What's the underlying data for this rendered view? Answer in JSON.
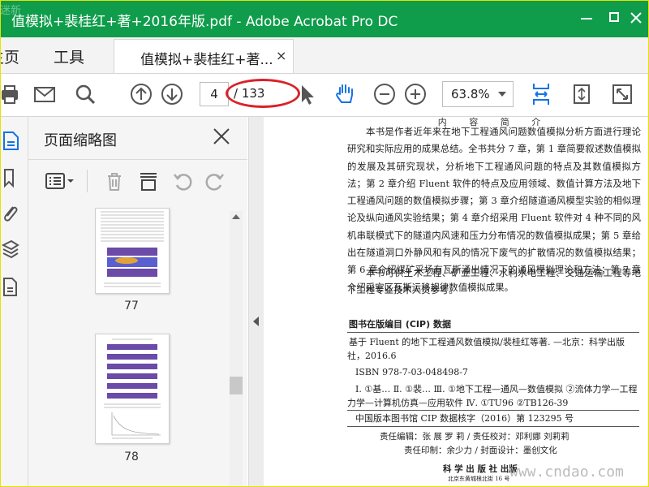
{
  "window": {
    "title": "值模拟+裴桂红+著+2016年版.pdf - Adobe Acrobat Pro DC",
    "watermark_logo": "迷新"
  },
  "tabs": {
    "nav": [
      "主页",
      "工具"
    ],
    "document_tab": "值模拟+裴桂红+著...",
    "close": "×"
  },
  "toolbar": {
    "current_page": "4",
    "total_pages": "/ 133",
    "zoom": "63.8%"
  },
  "panel": {
    "title": "页面缩略图",
    "thumbnails": [
      {
        "page": "77"
      },
      {
        "page": "78"
      }
    ]
  },
  "document": {
    "heading": "内 容 简 介",
    "para1": "本书是作者近年来在地下工程通风问题数值模拟分析方面进行理论研究和实际应用的成果总结。全书共分 7 章，第 1 章简要叙述数值模拟的发展及其研究现状，分析地下工程通风问题的特点及其数值模拟方法；第 2 章介绍 Fluent 软件的特点及应用领域、数值计算方法及地下工程通风问题的数值模拟步骤；第 3 章介绍隧道通风模型实验的相似理论及纵向通风实验结果；第 4 章介绍采用 Fluent 软件对 4 种不同的风机串联模式下的隧道内风速和压力分布情况的数值模拟成果；第 5 章给出在隧道洞口外静风和有风的情况下废气的扩散情况的数值模拟结果；第 6 章介绍煤矿采场有瓦斯涌出情况下的通风模拟理论和方法；第 7 章介绍采空区瓦斯运移规律数值模拟成果。",
    "para2": "本书可供土木工程、矿业工程、水利水电工程、交通运输工程等地下工程专业技术人员参考。",
    "cip_title": "图书在版编目 (CIP) 数据",
    "cip_line1": "基于 Fluent 的地下工程通风数值模拟/裴桂红等著. —北京：科学出版社，2016.6",
    "cip_isbn": "ISBN 978-7-03-048498-7",
    "cip_class": "Ⅰ. ①基…  Ⅱ. ①裴…  Ⅲ. ①地下工程—通风—数值模拟 ②流体力学—工程力学—计算机仿真—应用软件  Ⅳ. ①TU96 ②TB126-39",
    "cip_number": "中国版本图书馆 CIP 数据核字（2016）第 123295 号",
    "credit1": "责任编辑：张  展  罗  莉 / 责任校对：邓利娜  刘莉莉",
    "credit2": "责任印制：余少力 / 封面设计：墨创文化",
    "publisher": "科 学 出 版 社 出版",
    "address": "北京东黄城根北街 16 号"
  },
  "site_watermark": "www.cndao.com",
  "colors": {
    "titlebar": "#0f9d4b",
    "accent_blue": "#1473e6",
    "highlight_oval": "#d9222a"
  }
}
